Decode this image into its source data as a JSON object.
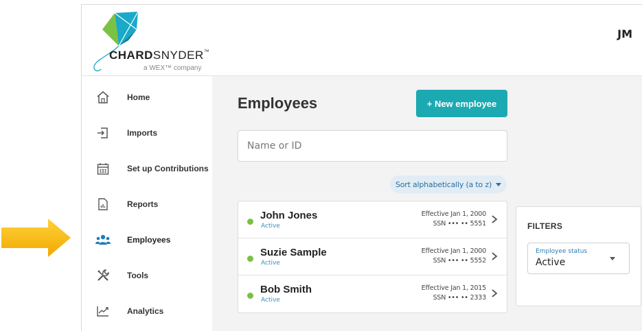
{
  "header": {
    "brand_bold": "CHARD",
    "brand_rest": "SNYDER",
    "brand_tm": "™",
    "tagline": "a WEX™ company",
    "user_initials": "JM"
  },
  "sidebar": {
    "items": [
      {
        "label": "Home",
        "icon": "home-icon"
      },
      {
        "label": "Imports",
        "icon": "import-icon"
      },
      {
        "label": "Set up Contributions",
        "icon": "calendar-icon"
      },
      {
        "label": "Reports",
        "icon": "report-icon"
      },
      {
        "label": "Employees",
        "icon": "people-icon",
        "active": true
      },
      {
        "label": "Tools",
        "icon": "tools-icon"
      },
      {
        "label": "Analytics",
        "icon": "analytics-icon"
      }
    ]
  },
  "main": {
    "title": "Employees",
    "new_button": "+ New employee",
    "search_placeholder": "Name or ID",
    "sort_label": "Sort alphabetically (a to z)",
    "employees": [
      {
        "name": "John Jones",
        "status": "Active",
        "effective": "Effective Jan 1, 2000",
        "ssn": "SSN ••• •• 5551"
      },
      {
        "name": "Suzie Sample",
        "status": "Active",
        "effective": "Effective Jan 1, 2000",
        "ssn": "SSN ••• •• 5552"
      },
      {
        "name": "Bob Smith",
        "status": "Active",
        "effective": "Effective Jan 1, 2015",
        "ssn": "SSN ••• •• 2333"
      }
    ]
  },
  "filters": {
    "title": "FILTERS",
    "status_label": "Employee status",
    "status_value": "Active"
  },
  "colors": {
    "accent": "#1ba9b2",
    "arrow": "#f7b500",
    "active_dot": "#7ac142",
    "nav_active_icon": "#1e7bbf"
  }
}
